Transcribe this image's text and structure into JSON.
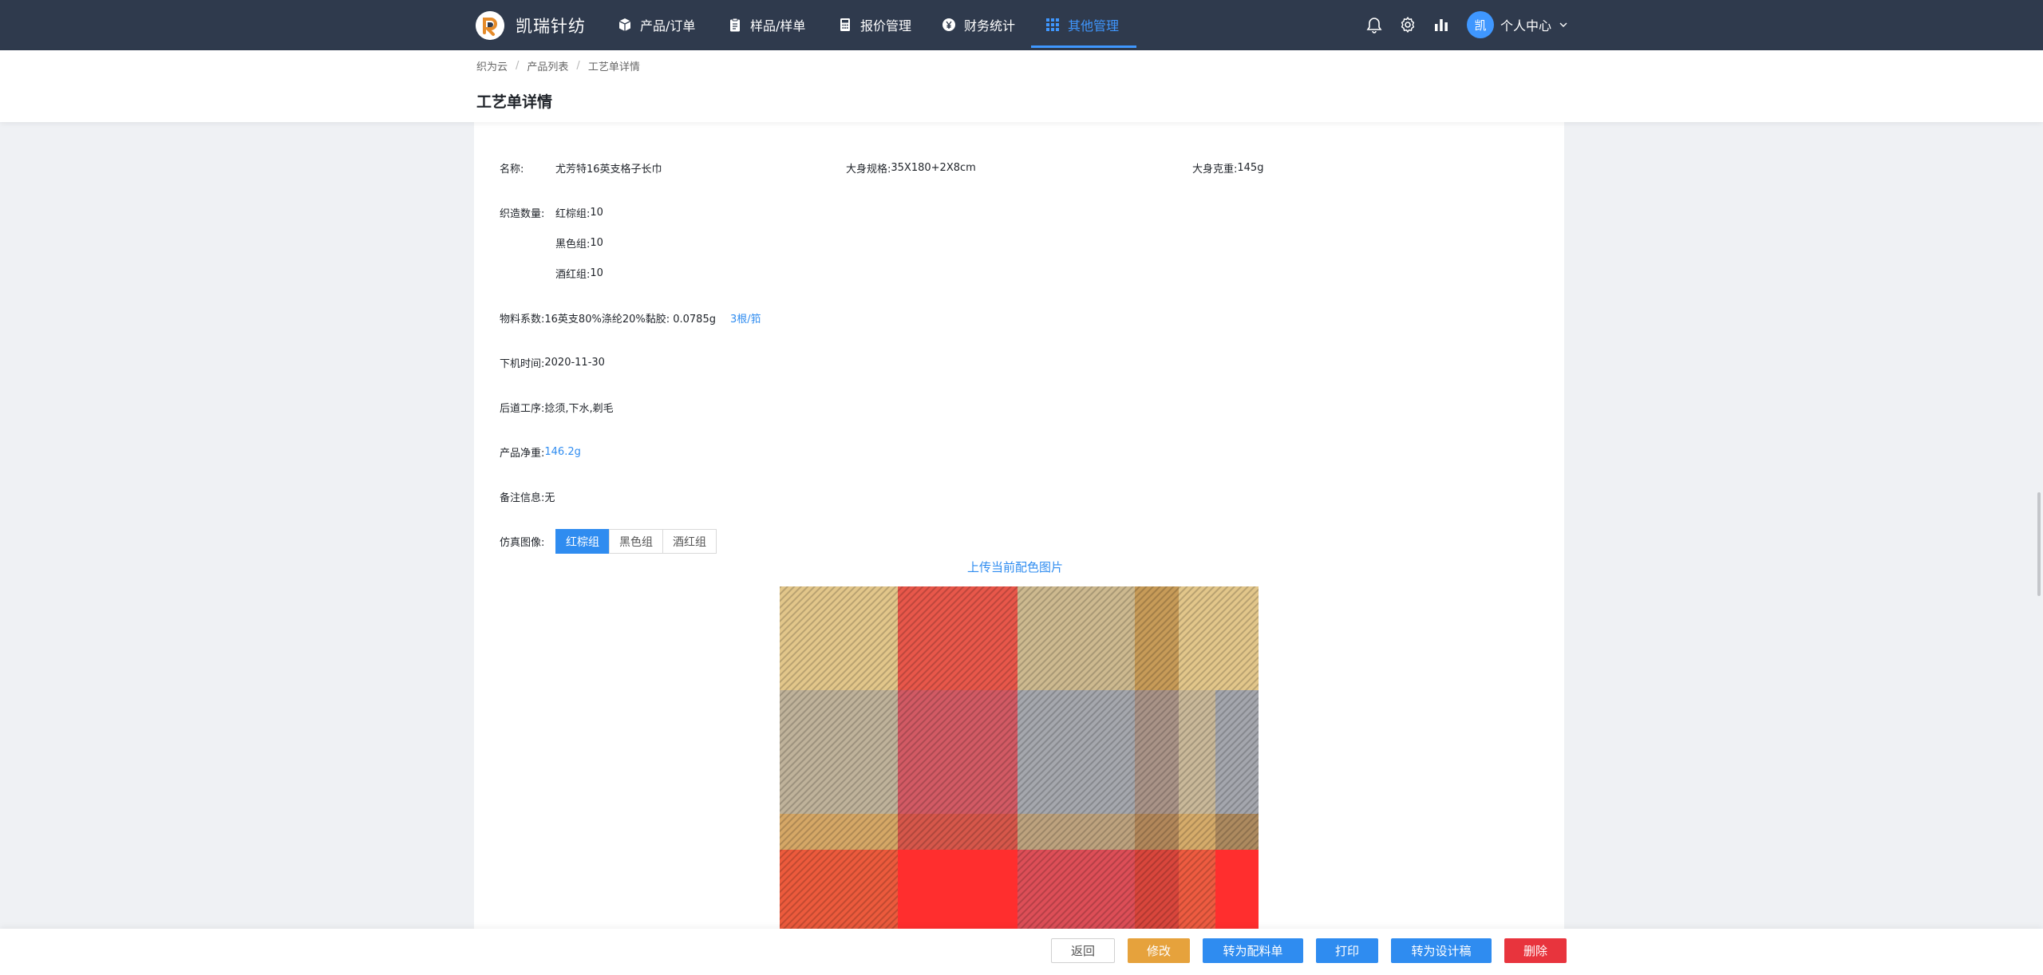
{
  "brand": {
    "name": "凯瑞针纺"
  },
  "nav": {
    "items": [
      {
        "label": "产品/订单",
        "icon": "cube-icon"
      },
      {
        "label": "样品/样单",
        "icon": "clipboard-icon"
      },
      {
        "label": "报价管理",
        "icon": "calculator-icon"
      },
      {
        "label": "财务统计",
        "icon": "yen-coin-icon"
      },
      {
        "label": "其他管理",
        "icon": "grid-icon",
        "active": true
      }
    ],
    "right_icons": [
      "bell-icon",
      "gear-icon",
      "bar-chart-icon"
    ],
    "user": {
      "avatar_text": "凯",
      "label": "个人中心"
    },
    "colors": {
      "bar": "#2f3a4d",
      "accent": "#3f97ff"
    }
  },
  "breadcrumb": [
    "织为云",
    "产品列表",
    "工艺单详情"
  ],
  "page_title": "工艺单详情",
  "details": {
    "name_label": "名称:",
    "name_value": "尤芳特16英支格子长巾",
    "spec_label": "大身规格:",
    "spec_value": "35X180+2X8cm",
    "weight_label": "大身克重:",
    "weight_value": "145g",
    "quantity_label": "织造数量:",
    "quantities": [
      {
        "group": "红棕组:",
        "value": "10"
      },
      {
        "group": "黑色组:",
        "value": "10"
      },
      {
        "group": "酒红组:",
        "value": "10"
      }
    ],
    "material_label": "物料系数:",
    "material_value": "16英支80%涤纶20%黏胶: 0.0785g",
    "material_link": "3根/筘",
    "machine_time_label": "下机时间:",
    "machine_time_value": "2020-11-30",
    "process_label": "后道工序:",
    "process_value": "捻须,下水,剃毛",
    "net_weight_label": "产品净重:",
    "net_weight_value": "146.2g",
    "remark_label": "备注信息:",
    "remark_value": "无",
    "sim_label": "仿真图像:",
    "sim_tabs": [
      {
        "label": "红棕组",
        "active": true
      },
      {
        "label": "黑色组",
        "active": false
      },
      {
        "label": "酒红组",
        "active": false
      }
    ],
    "upload_link": "上传当前配色图片"
  },
  "actions": {
    "back": "返回",
    "edit": "修改",
    "to_material": "转为配料单",
    "print": "打印",
    "to_design": "转为设计稿",
    "delete": "删除"
  },
  "colors": {
    "link": "#2f8cf0",
    "edit": "#e6a23c",
    "delete": "#e8343d",
    "primary": "#2f8cf0"
  }
}
